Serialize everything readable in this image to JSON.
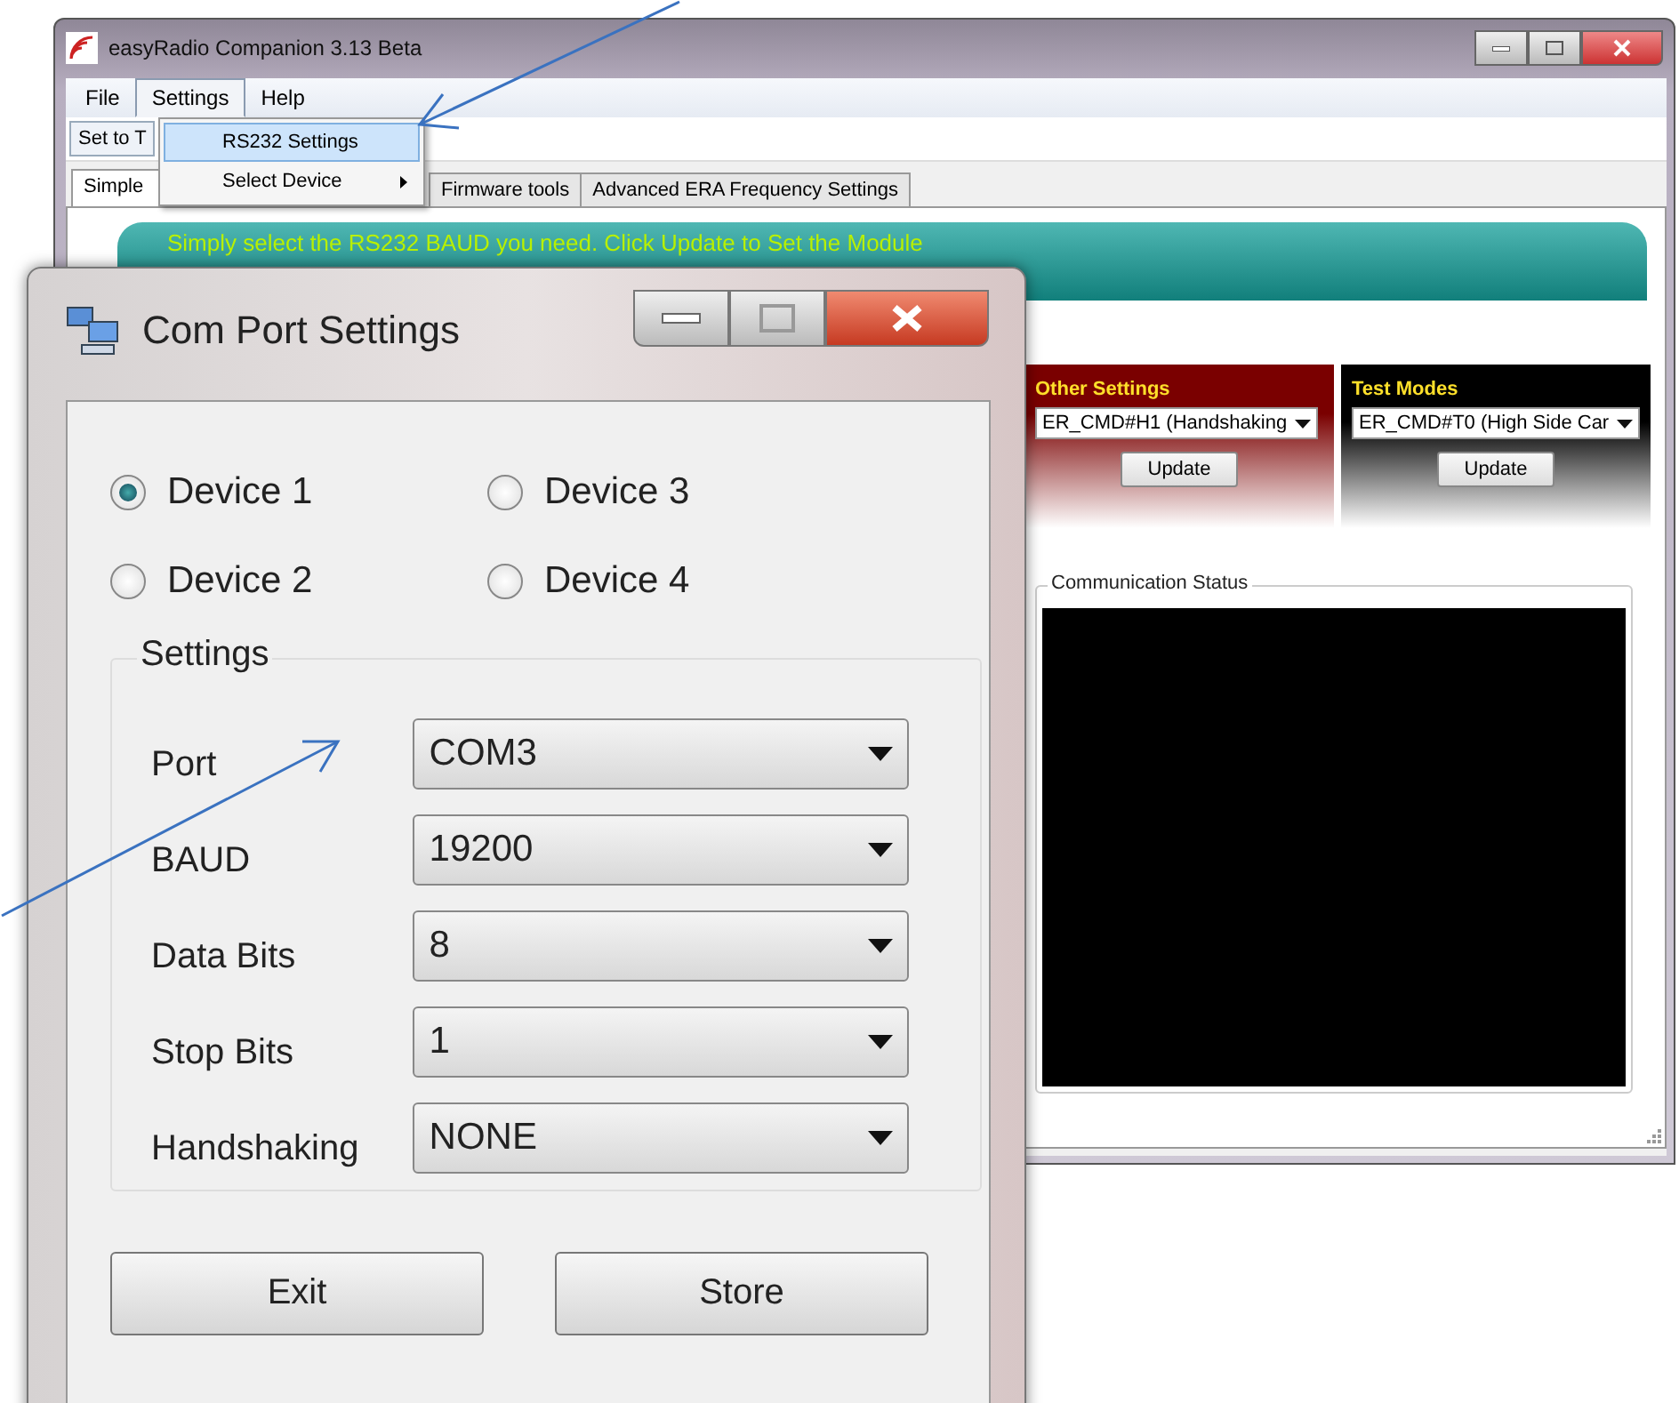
{
  "window": {
    "title": "easyRadio Companion 3.13 Beta"
  },
  "menu": [
    {
      "label": "File",
      "selected": false
    },
    {
      "label": "Settings",
      "selected": true
    },
    {
      "label": "Help",
      "selected": false
    }
  ],
  "settings_menu": [
    {
      "label": "RS232 Settings",
      "selected": true,
      "submenu": false
    },
    {
      "label": "Select Device",
      "selected": false,
      "submenu": true
    }
  ],
  "toolbar": {
    "button": "Set to T"
  },
  "tabs": [
    {
      "label": "Simple",
      "selected": true
    },
    {
      "label": "Firmware tools",
      "selected": false
    },
    {
      "label": "Advanced ERA Frequency Settings",
      "selected": false
    }
  ],
  "banner": "Simply select the RS232 BAUD you need. Click Update to Set the Module",
  "panels": [
    {
      "kind": "red",
      "title": "Other Settings",
      "value": "ER_CMD#H1 (Handshaking",
      "button": "Update"
    },
    {
      "kind": "black",
      "title": "Test Modes",
      "value": "ER_CMD#T0 (High Side Car",
      "button": "Update"
    }
  ],
  "communication_status": {
    "title": "Communication Status"
  },
  "dialog": {
    "title": "Com Port Settings",
    "devices": [
      {
        "label": "Device 1",
        "selected": true
      },
      {
        "label": "Device 2",
        "selected": false
      },
      {
        "label": "Device 3",
        "selected": false
      },
      {
        "label": "Device 4",
        "selected": false
      }
    ],
    "group": "Settings",
    "fields": [
      {
        "label": "Port",
        "value": "COM3"
      },
      {
        "label": "BAUD",
        "value": "19200"
      },
      {
        "label": "Data Bits",
        "value": "8"
      },
      {
        "label": "Stop Bits",
        "value": "1"
      },
      {
        "label": "Handshaking",
        "value": "NONE"
      }
    ],
    "buttons": [
      "Exit",
      "Store"
    ]
  }
}
